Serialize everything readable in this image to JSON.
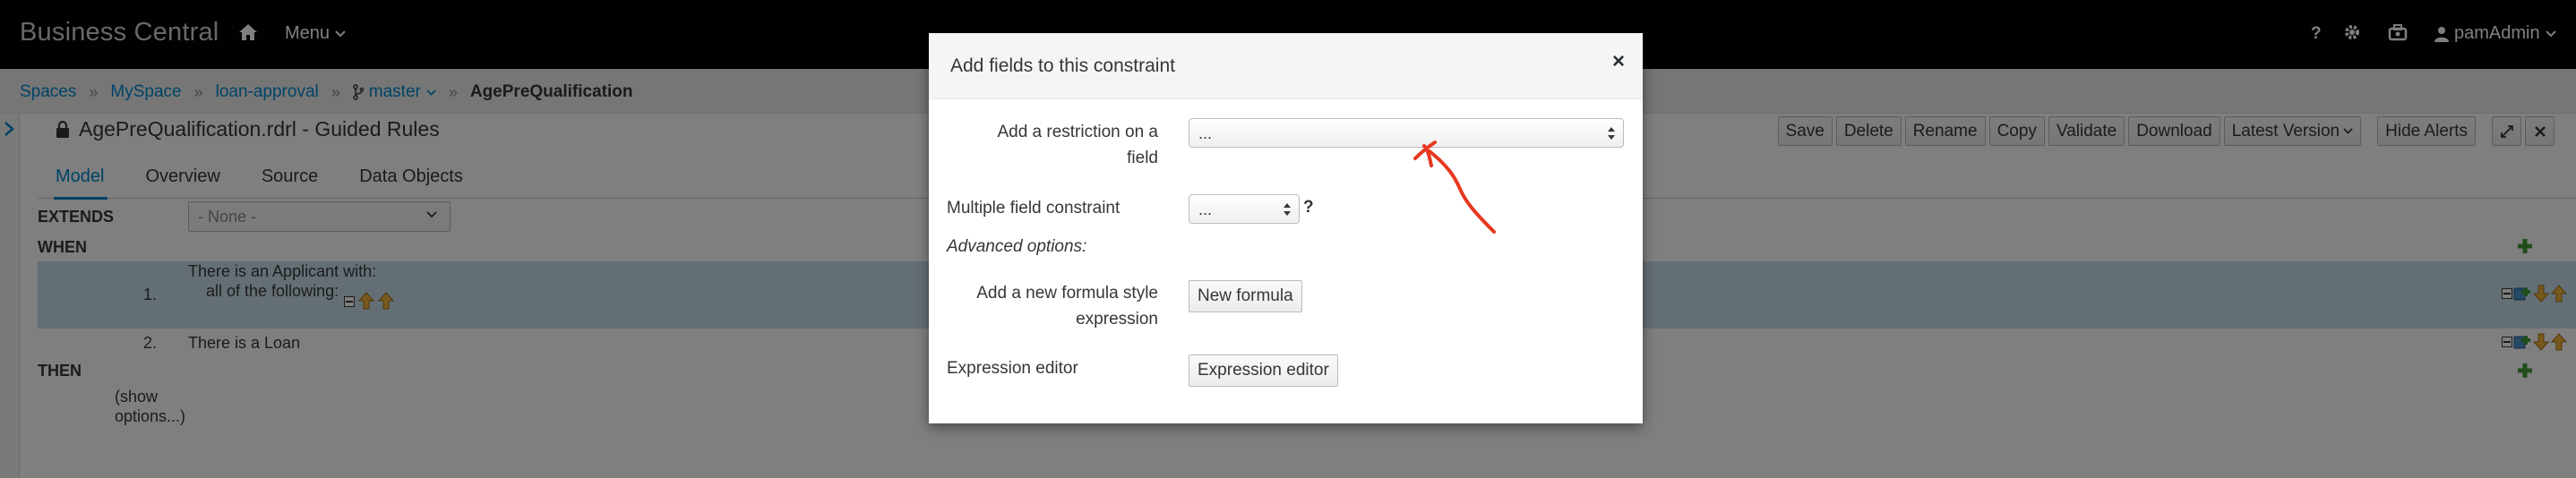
{
  "app": {
    "brand": "Business Central",
    "menu_label": "Menu",
    "user_name": "pamAdmin"
  },
  "icons": {
    "home": "home-icon",
    "help": "help-icon",
    "settings": "gear-icon",
    "tasks": "briefcase-icon",
    "user": "user-icon",
    "branch": "branch-icon",
    "lock": "lock-icon"
  },
  "breadcrumb": {
    "items": [
      "Spaces",
      "MySpace",
      "loan-approval",
      "master"
    ],
    "current": "AgePreQualification"
  },
  "editor": {
    "title": "AgePreQualification.rdrl - Guided Rules",
    "toolbar": [
      "Save",
      "Delete",
      "Rename",
      "Copy",
      "Validate",
      "Download"
    ],
    "version_label": "Latest Version",
    "hide_alerts_label": "Hide Alerts",
    "tabs": [
      "Model",
      "Overview",
      "Source",
      "Data Objects"
    ],
    "active_tab": "Model"
  },
  "rule": {
    "extends_label": "EXTENDS",
    "extends_value": "- None -",
    "when_label": "WHEN",
    "then_label": "THEN",
    "conditions": [
      {
        "number": "1.",
        "line1": "There is an Applicant with:",
        "line2": "all of the following:"
      },
      {
        "number": "2.",
        "line1": "There is a Loan"
      }
    ],
    "show_options": [
      "(show",
      "options...)"
    ]
  },
  "modal": {
    "title": "Add fields to this constraint",
    "close_label": "×",
    "restriction_label_1": "Add a restriction on a",
    "restriction_label_2": "field",
    "restriction_value": "...",
    "multiple_label": "Multiple field constraint",
    "multiple_value": "...",
    "multiple_help": "?",
    "advanced_label": "Advanced options:",
    "formula_label_1": "Add a new formula style",
    "formula_label_2": "expression",
    "formula_button": "New formula",
    "expr_label": "Expression editor",
    "expr_button": "Expression editor"
  },
  "colors": {
    "link": "#0088ce",
    "navbar": "#030303",
    "highlight_row": "#c9dfea",
    "annotation": "#e8381f",
    "add_icon": "#3f9c35"
  }
}
